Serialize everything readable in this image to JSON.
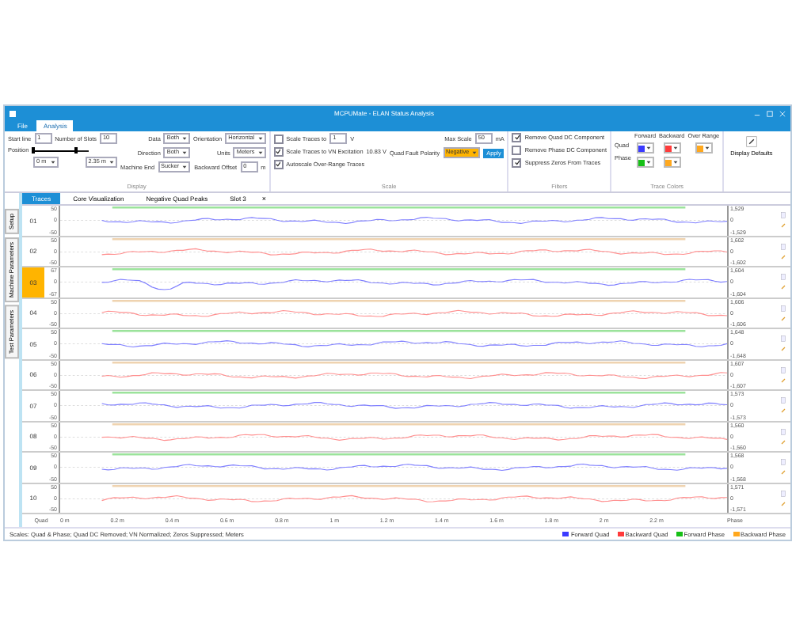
{
  "window": {
    "title": "MCPUMate - ELAN Status Analysis"
  },
  "ribbon_tabs": [
    {
      "label": "File",
      "selected": false
    },
    {
      "label": "Analysis",
      "selected": true
    }
  ],
  "display_group": {
    "label": "Display",
    "start_line": {
      "label": "Start line",
      "value": "1"
    },
    "number_of_slots": {
      "label": "Number of Slots",
      "value": "10"
    },
    "position": {
      "label": "Position",
      "from": "0 m",
      "to": "2.35 m",
      "level": 0.8
    },
    "data": {
      "label": "Data",
      "value": "Both"
    },
    "direction": {
      "label": "Direction",
      "value": "Both"
    },
    "machine_end": {
      "label": "Machine End",
      "value": "Sucker"
    },
    "orientation": {
      "label": "Orientation",
      "value": "Horizontal"
    },
    "units": {
      "label": "Units",
      "value": "Meters"
    },
    "backward_offset": {
      "label": "Backward Offset",
      "value": "0",
      "unit": "m"
    }
  },
  "scale_group": {
    "label": "Scale",
    "options": [
      {
        "label": "Scale Traces to",
        "checked": false,
        "value": "1",
        "unit": "V"
      },
      {
        "label": "Scale Traces to VN Excitation",
        "checked": true,
        "value": "10.83 V"
      },
      {
        "label": "Autoscale Over-Range Traces",
        "checked": true
      }
    ],
    "max_scale": {
      "label": "Max Scale",
      "value": "50",
      "unit": "mA"
    },
    "polarity": {
      "label": "Quad Fault Polarity",
      "value": "Negative"
    },
    "apply": "Apply"
  },
  "filters_group": {
    "label": "Filters",
    "options": [
      {
        "label": "Remove Quad DC Component",
        "checked": true
      },
      {
        "label": "Remove Phase DC Component",
        "checked": false
      },
      {
        "label": "Suppress Zeros From Traces",
        "checked": true
      }
    ]
  },
  "colors_group": {
    "label": "Trace Colors",
    "row_labels": [
      "Quad",
      "Phase"
    ],
    "columns": [
      {
        "label": "Forward",
        "swatches": [
          {
            "color": "#3b3bff"
          },
          {
            "color": "#16c016"
          }
        ]
      },
      {
        "label": "Backward",
        "swatches": [
          {
            "color": "#ff3b3b"
          },
          {
            "color": "#ffa81e"
          }
        ]
      },
      {
        "label": "Over Range",
        "swatches": [
          {
            "color": "#ffa81e"
          }
        ]
      }
    ]
  },
  "defaults_button": "Display Defaults",
  "side_tabs": [
    {
      "label": "Setup",
      "selected": false
    },
    {
      "label": "Machine Parameters",
      "selected": false
    },
    {
      "label": "Test Parameters",
      "selected": false
    }
  ],
  "doc_tabs": [
    {
      "label": "Traces",
      "selected": true
    },
    {
      "label": "Core Visualization",
      "selected": false
    },
    {
      "label": "Negative Quad Peaks",
      "selected": false
    },
    {
      "label": "Slot 3",
      "selected": false
    }
  ],
  "close_tab": "×",
  "traces": [
    {
      "label": "01",
      "kind": "forward",
      "selected": false,
      "ticks": [
        "50",
        "0",
        "-50"
      ],
      "readings": [
        "1,529",
        "0",
        "-1,529"
      ]
    },
    {
      "label": "02",
      "kind": "backward",
      "selected": false,
      "ticks": [
        "50",
        "0",
        "-50"
      ],
      "readings": [
        "1,602",
        "0",
        "-1,602"
      ]
    },
    {
      "label": "03",
      "kind": "forward",
      "selected": true,
      "ticks": [
        "67",
        "0",
        "-67"
      ],
      "readings": [
        "1,604",
        "0",
        "-1,604"
      ]
    },
    {
      "label": "04",
      "kind": "backward",
      "selected": false,
      "ticks": [
        "50",
        "0",
        "-50"
      ],
      "readings": [
        "1,606",
        "0",
        "-1,606"
      ]
    },
    {
      "label": "05",
      "kind": "forward",
      "selected": false,
      "ticks": [
        "50",
        "0",
        "-50"
      ],
      "readings": [
        "1,648",
        "0",
        "-1,648"
      ]
    },
    {
      "label": "06",
      "kind": "backward",
      "selected": false,
      "ticks": [
        "50",
        "0",
        "-50"
      ],
      "readings": [
        "1,607",
        "0",
        "-1,607"
      ]
    },
    {
      "label": "07",
      "kind": "forward",
      "selected": false,
      "ticks": [
        "50",
        "0",
        "-50"
      ],
      "readings": [
        "1,573",
        "0",
        "-1,573"
      ]
    },
    {
      "label": "08",
      "kind": "backward",
      "selected": false,
      "ticks": [
        "50",
        "0",
        "-50"
      ],
      "readings": [
        "1,560",
        "0",
        "-1,560"
      ]
    },
    {
      "label": "09",
      "kind": "forward",
      "selected": false,
      "ticks": [
        "50",
        "0",
        "-50"
      ],
      "readings": [
        "1,568",
        "0",
        "-1,568"
      ]
    },
    {
      "label": "10",
      "kind": "backward",
      "selected": false,
      "ticks": [
        "50",
        "0",
        "-50"
      ],
      "readings": [
        "1,571",
        "0",
        "-1,571"
      ]
    }
  ],
  "x_axis": {
    "left_label": "Quad",
    "right_label": "Phase",
    "ticks": [
      "0 m",
      "0.2 m",
      "0.4 m",
      "0.6 m",
      "0.8 m",
      "1 m",
      "1.2 m",
      "1.4 m",
      "1.6 m",
      "1.8 m",
      "2 m",
      "2.2 m"
    ]
  },
  "status_bar": {
    "text": "Scales: Quad & Phase; Quad DC Removed; VN Normalized; Zeros Suppressed; Meters",
    "legend": [
      {
        "label": "Forward Quad",
        "color": "#3b3bff"
      },
      {
        "label": "Backward Quad",
        "color": "#ff3b3b"
      },
      {
        "label": "Forward Phase",
        "color": "#16c016"
      },
      {
        "label": "Backward Phase",
        "color": "#ffa81e"
      }
    ]
  }
}
